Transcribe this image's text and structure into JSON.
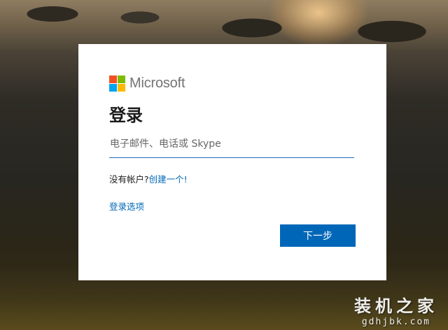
{
  "colors": {
    "accent": "#0067b8",
    "logo_red": "#f25022",
    "logo_green": "#7fba00",
    "logo_blue": "#00a4ef",
    "logo_yellow": "#ffb900"
  },
  "brand": {
    "logo_text": "Microsoft"
  },
  "login": {
    "title": "登录",
    "email_placeholder": "电子邮件、电话或 Skype",
    "email_value": "",
    "no_account_text": "没有帐户?",
    "create_account_link": "创建一个!",
    "signin_options_link": "登录选项",
    "next_button": "下一步"
  },
  "watermark": {
    "name": "装机之家",
    "url": "gdhjbk.com"
  }
}
